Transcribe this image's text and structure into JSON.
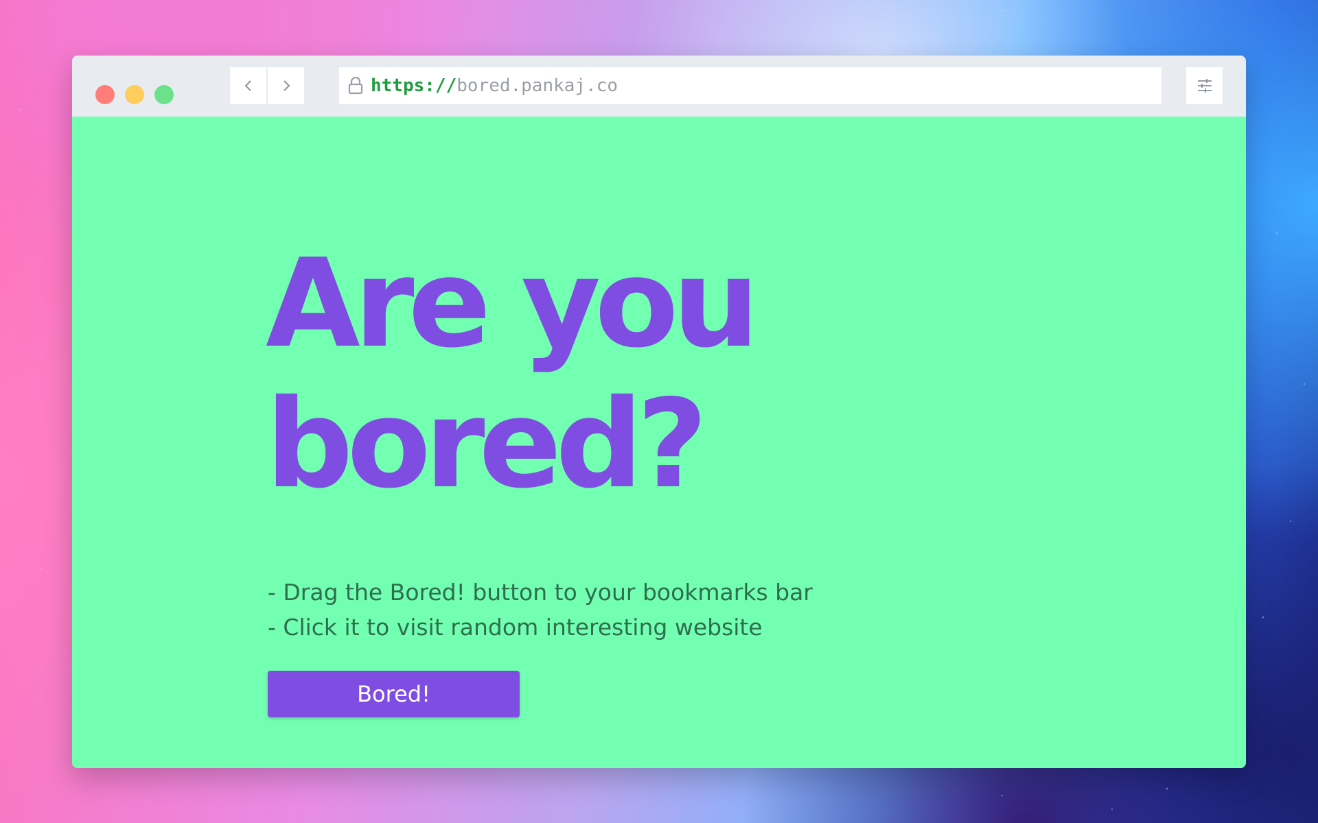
{
  "browser": {
    "url_scheme": "https://",
    "url_host": "bored.pankaj.co",
    "icons": {
      "back": "chevron-left-icon",
      "forward": "chevron-right-icon",
      "lock": "lock-icon",
      "menu": "sliders-icon"
    }
  },
  "page": {
    "headline_line1": "Are you",
    "headline_line2": "bored?",
    "instructions": [
      "- Drag the Bored! button to your bookmarks bar",
      "- Click it to visit random interesting website"
    ],
    "button_label": "Bored!"
  },
  "colors": {
    "page_background": "#72ffb1",
    "accent_purple": "#7f4de1",
    "instruction_text": "#2e6e4d",
    "url_scheme_green": "#1f9e3f"
  }
}
